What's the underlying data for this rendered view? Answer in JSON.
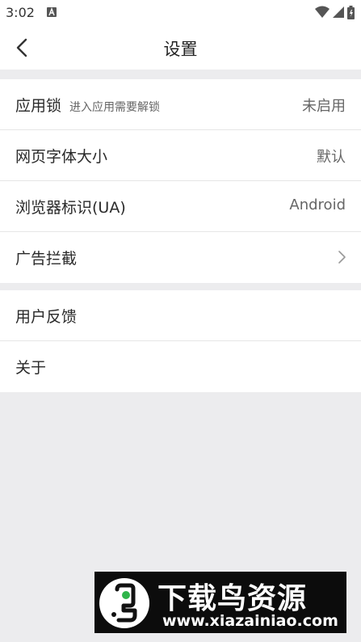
{
  "status_bar": {
    "time": "3:02"
  },
  "header": {
    "title": "设置"
  },
  "settings_group_1": [
    {
      "label": "应用锁",
      "sublabel": "进入应用需要解锁",
      "value": "未启用"
    },
    {
      "label": "网页字体大小",
      "value": "默认"
    },
    {
      "label": "浏览器标识(UA)",
      "value": "Android"
    },
    {
      "label": "广告拦截"
    }
  ],
  "settings_group_2": [
    {
      "label": "用户反馈"
    },
    {
      "label": "关于"
    }
  ],
  "watermark": {
    "brand": "下载鸟资源",
    "url": "www.xiazainiao.com"
  },
  "colors": {
    "page_background": "#ececee",
    "card_background": "#ffffff",
    "accent_green": "#2fb54a"
  }
}
